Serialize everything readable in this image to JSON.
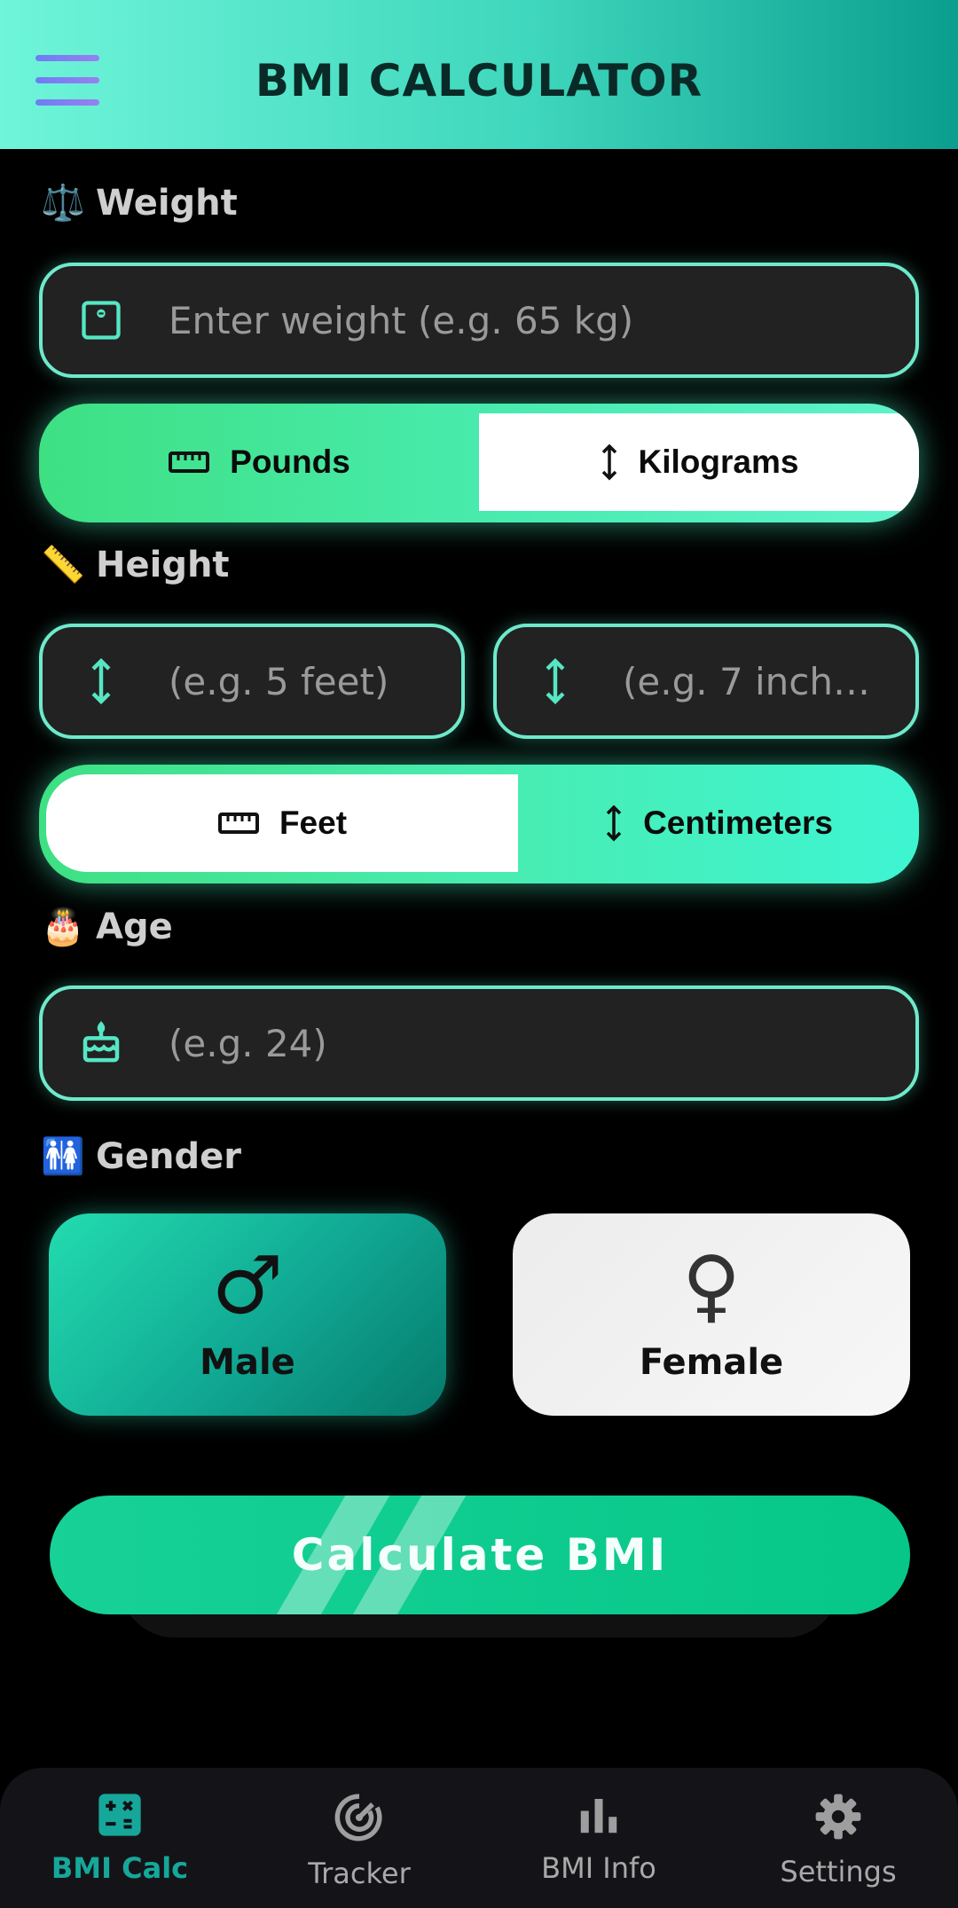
{
  "header": {
    "title": "BMI CALCULATOR"
  },
  "weight": {
    "label": "Weight",
    "emoji": "⚖️",
    "placeholder": "Enter weight (e.g. 65 kg)",
    "units": [
      {
        "label": "Pounds"
      },
      {
        "label": "Kilograms"
      }
    ],
    "selected": "Kilograms"
  },
  "height": {
    "label": "Height",
    "emoji": "📏",
    "feet_placeholder": "(e.g. 5 feet)",
    "inch_placeholder": "(e.g. 7 inch…",
    "units": [
      {
        "label": "Feet"
      },
      {
        "label": "Centimeters"
      }
    ],
    "selected": "Feet"
  },
  "age": {
    "label": "Age",
    "emoji": "🎂",
    "placeholder": "(e.g. 24)"
  },
  "gender": {
    "label": "Gender",
    "emoji": "🚻",
    "options": [
      {
        "label": "Male",
        "symbol": "♂"
      },
      {
        "label": "Female",
        "symbol": "♀"
      }
    ],
    "selected": "Male"
  },
  "calculate_label": "Calculate BMI",
  "nav": [
    {
      "label": "BMI Calc",
      "icon": "calculator-icon",
      "active": true
    },
    {
      "label": "Tracker",
      "icon": "tracker-target-icon"
    },
    {
      "label": "BMI Info",
      "icon": "bar-chart-icon"
    },
    {
      "label": "Settings",
      "icon": "gear-icon"
    }
  ],
  "colors": {
    "accent": "#56e6c3",
    "header_start": "#6ff5d9",
    "header_end": "#0b9e8f",
    "button": "#0fcb8f",
    "nav_active": "#16a79a"
  }
}
